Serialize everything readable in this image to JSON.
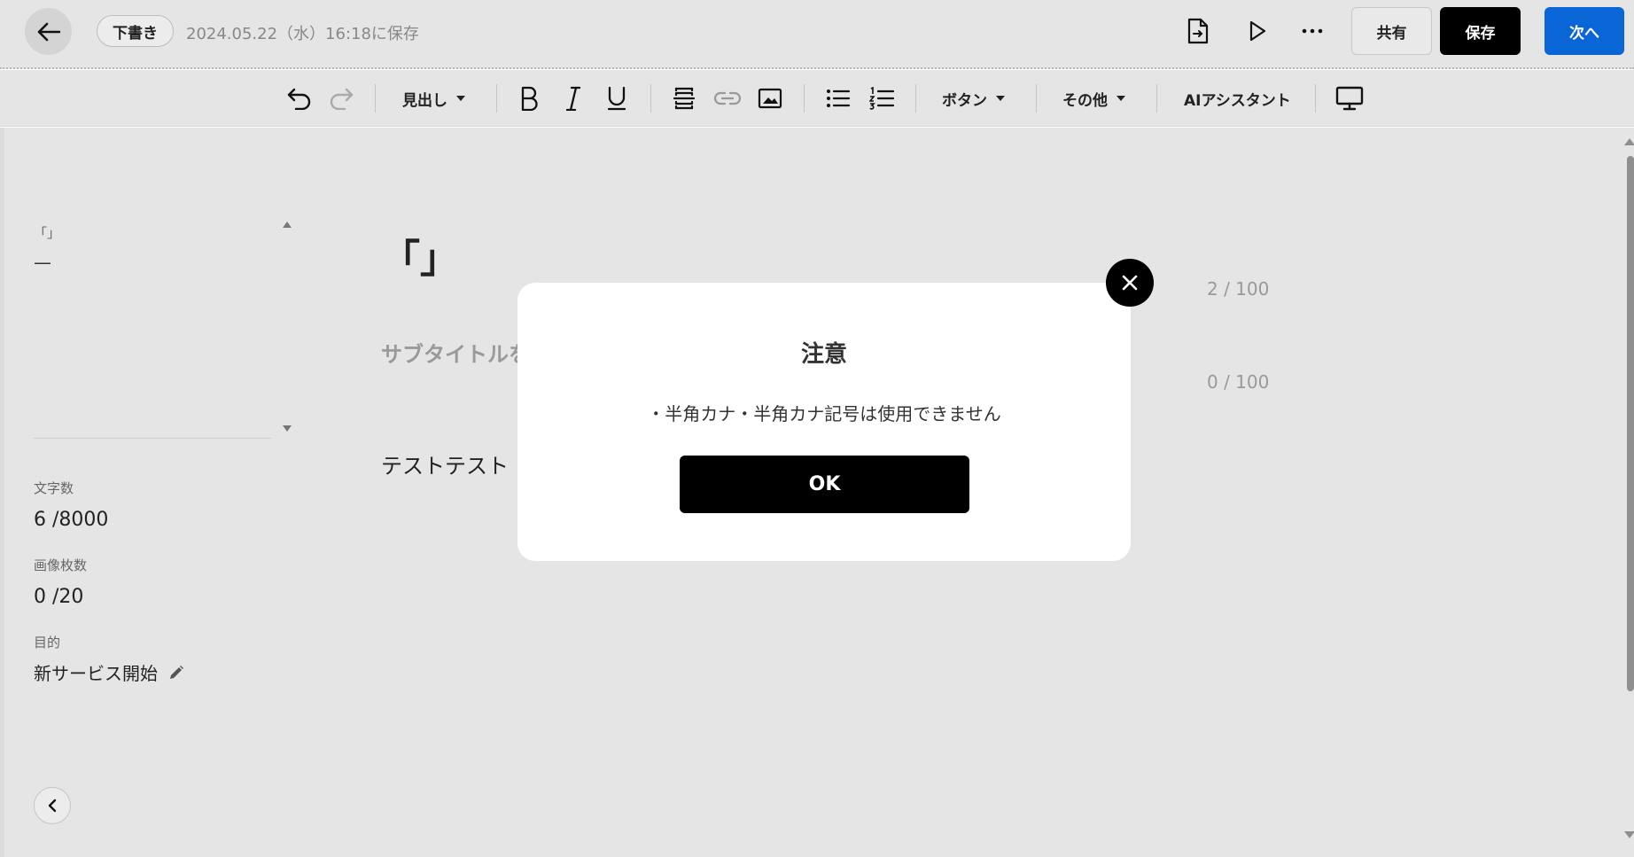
{
  "header": {
    "status_badge": "下書き",
    "save_status": "2024.05.22（水）16:18に保存",
    "share_label": "共有",
    "save_label": "保存",
    "next_label": "次へ"
  },
  "toolbar": {
    "heading_label": "見出し",
    "button_label": "ボタン",
    "other_label": "その他",
    "ai_assistant_label": "AIアシスタント"
  },
  "sidebar": {
    "outline_title": "「」",
    "outline_dash": "—",
    "char_count_label": "文字数",
    "char_count_value": "6 /8000",
    "image_count_label": "画像枚数",
    "image_count_value": "0 /20",
    "purpose_label": "目的",
    "purpose_value": "新サービス開始"
  },
  "editor": {
    "title": "「」",
    "title_count": "2 / 100",
    "subtitle_placeholder": "サブタイトルを",
    "subtitle_count": "0 / 100",
    "body": "テストテスト"
  },
  "dialog": {
    "title": "注意",
    "message": "・半角カナ・半角カナ記号は使用できません",
    "ok_label": "OK"
  }
}
